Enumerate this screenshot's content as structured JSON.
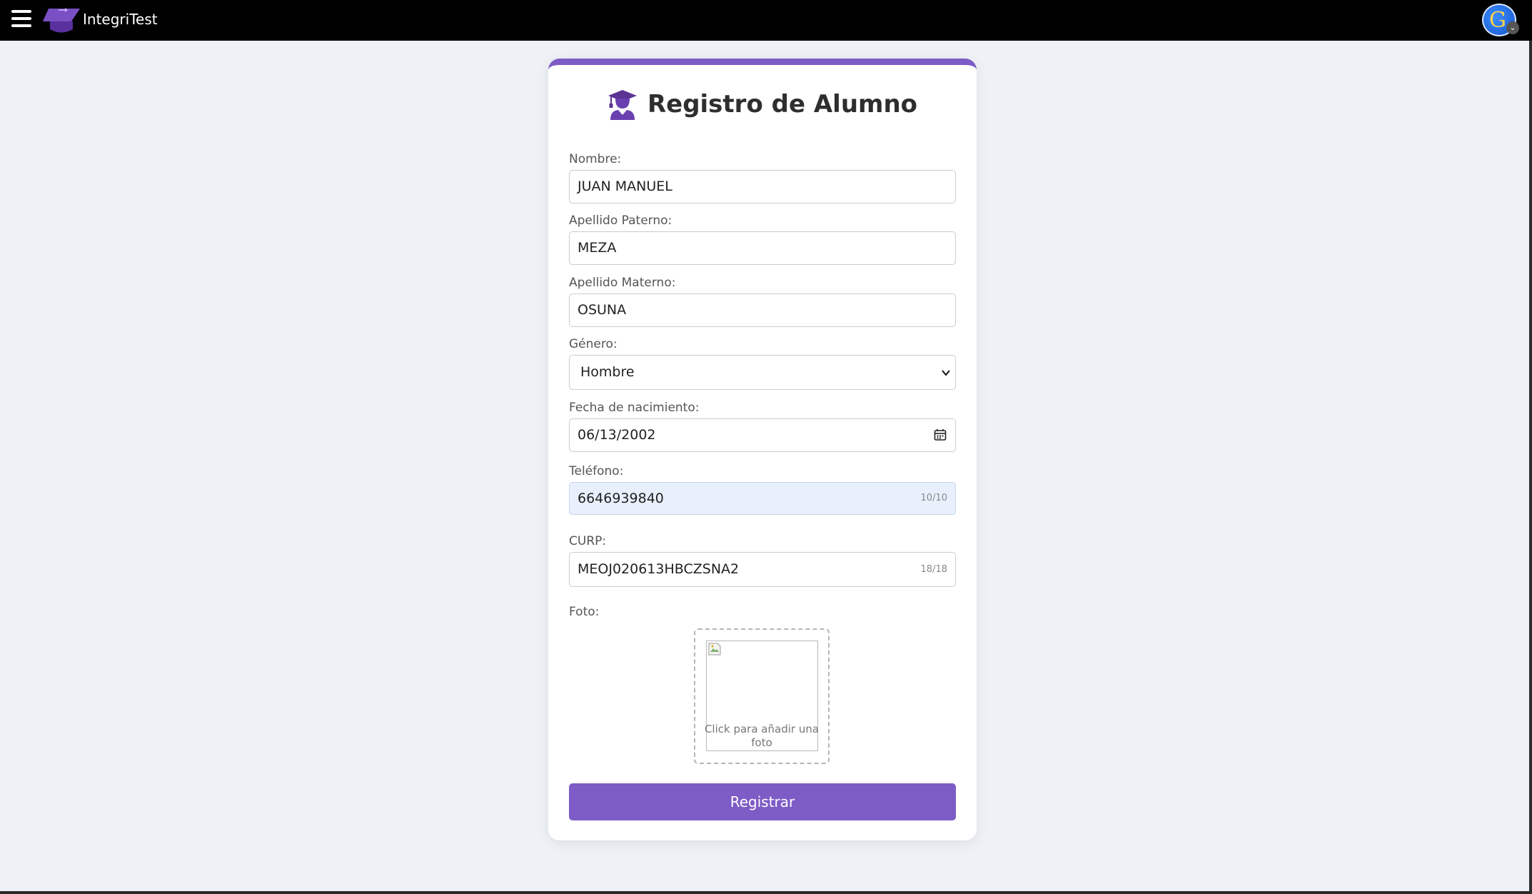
{
  "app": {
    "brand": "IntegriTest"
  },
  "form": {
    "title": "Registro de Alumno",
    "fields": {
      "nombre": {
        "label": "Nombre:",
        "value": "JUAN MANUEL"
      },
      "apellido_paterno": {
        "label": "Apellido Paterno:",
        "value": "MEZA"
      },
      "apellido_materno": {
        "label": "Apellido Materno:",
        "value": "OSUNA"
      },
      "genero": {
        "label": "Género:",
        "value": "Hombre"
      },
      "fecha_nacimiento": {
        "label": "Fecha de nacimiento:",
        "value": "06/13/2002"
      },
      "telefono": {
        "label": "Teléfono:",
        "value": "6646939840",
        "counter": "10/10"
      },
      "curp": {
        "label": "CURP:",
        "value": "MEOJ020613HBCZSNA2",
        "counter": "18/18"
      },
      "foto": {
        "label": "Foto:",
        "placeholder_text": "Click para añadir una foto"
      }
    },
    "submit_label": "Registrar"
  },
  "icons": {
    "menu": "hamburger-menu-icon",
    "logo": "graduation-cap-icon",
    "title": "user-graduate-icon",
    "calendar": "calendar-icon",
    "select": "chevron-down-icon",
    "avatar_caret": "chevron-down-icon"
  },
  "colors": {
    "accent": "#7e5cc6",
    "topbar": "#000000",
    "background": "#eef1f5",
    "autofill": "#e8f0fe"
  }
}
